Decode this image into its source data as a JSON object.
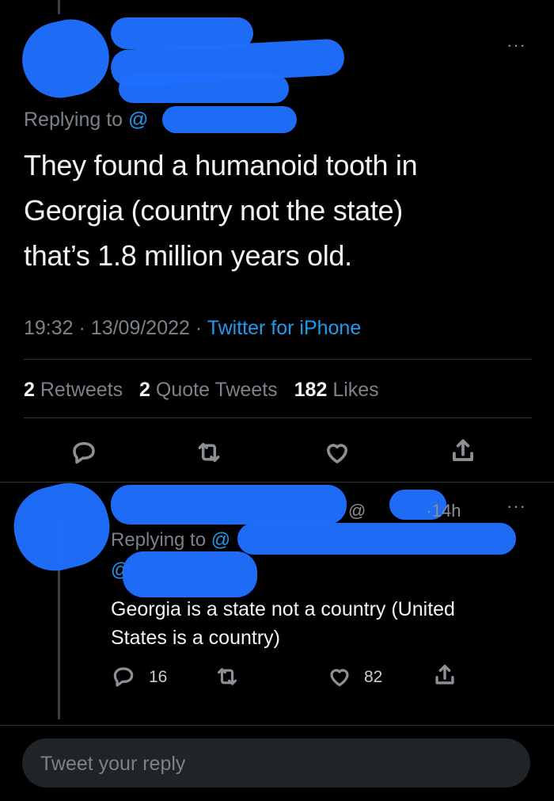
{
  "main_tweet": {
    "replying_prefix": "Replying to",
    "replying_handle": "@",
    "text_lines": [
      "They found a humanoid tooth in",
      "Georgia (country not the state)",
      "that’s 1.8 million years old."
    ],
    "time": "19:32",
    "date": "13/09/2022",
    "source": "Twitter for iPhone",
    "retweets_count": "2",
    "retweets_label": "Retweets",
    "quotes_count": "2",
    "quotes_label": "Quote Tweets",
    "likes_count": "182",
    "likes_label": "Likes",
    "more_label": "···"
  },
  "reply_tweet": {
    "handle_partial": "@",
    "time": "·14h",
    "more_label": "···",
    "replying_prefix": "Replying to",
    "replying_handle": "@",
    "mention": "@",
    "text_lines": [
      "Georgia is a state not a country (United",
      "States is a country)"
    ],
    "reply_count": "16",
    "like_count": "82"
  },
  "composer": {
    "placeholder": "Tweet your reply"
  },
  "colors": {
    "accent": "#1d9bf0",
    "censor": "#1f6fff",
    "background": "#000000"
  },
  "icons": [
    "reply-icon",
    "retweet-icon",
    "like-icon",
    "share-icon",
    "more-icon"
  ]
}
